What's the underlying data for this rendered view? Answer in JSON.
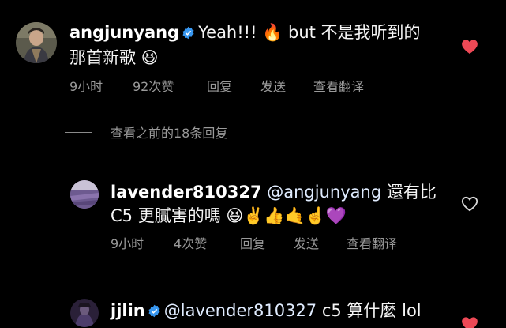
{
  "comments": [
    {
      "username": "angjunyang",
      "text_line1": "Yeah!!! 🔥 but 不是我听到的",
      "text_line2": "那首新歌 😆",
      "time": "9小时",
      "likes": "92次赞",
      "reply": "回复",
      "send": "发送",
      "translate": "查看翻译",
      "liked": true,
      "verified": true
    },
    {
      "view_previous": "查看之前的18条回复"
    },
    {
      "username": "lavender810327",
      "mention": "@angjunyang",
      "text_line1_rest": " 還有比",
      "text_line2": "C5 更膩害的嗎 😆✌️👍🤙☝️💜",
      "time": "9小时",
      "likes": "4次赞",
      "reply": "回复",
      "send": "发送",
      "translate": "查看翻译",
      "liked": false,
      "verified": false
    },
    {
      "username": "jjlin",
      "mention": "@lavender810327",
      "text_line1_rest": " c5 算什麼 lol",
      "liked": true,
      "verified": true
    }
  ],
  "colors": {
    "background": "#000000",
    "heart_red": "#ed4956",
    "verified_blue": "#3897f0",
    "meta_gray": "#9a9a9a"
  }
}
